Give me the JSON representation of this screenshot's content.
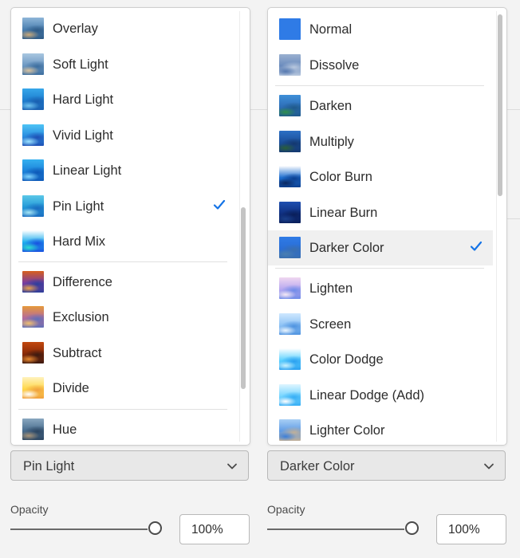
{
  "left": {
    "items": [
      {
        "label": "Overlay",
        "thumb": "ov"
      },
      {
        "label": "Soft Light",
        "thumb": "soft"
      },
      {
        "label": "Hard Light",
        "thumb": "hard"
      },
      {
        "label": "Vivid Light",
        "thumb": "vivid"
      },
      {
        "label": "Linear Light",
        "thumb": "linl"
      },
      {
        "label": "Pin Light",
        "thumb": "pin",
        "checked": true
      },
      {
        "label": "Hard Mix",
        "thumb": "mix"
      },
      {
        "label": "Difference",
        "thumb": "diff"
      },
      {
        "label": "Exclusion",
        "thumb": "excl"
      },
      {
        "label": "Subtract",
        "thumb": "sub"
      },
      {
        "label": "Divide",
        "thumb": "div"
      },
      {
        "label": "Hue",
        "thumb": "hue"
      }
    ],
    "picker": {
      "selected": "Pin Light"
    },
    "opacity": {
      "label": "Opacity",
      "value": "100%",
      "level": 1.0
    }
  },
  "right": {
    "items": [
      {
        "label": "Normal",
        "thumb": "normal"
      },
      {
        "label": "Dissolve",
        "thumb": "dissolve"
      },
      {
        "label": "Darken",
        "thumb": "darken"
      },
      {
        "label": "Multiply",
        "thumb": "multiply"
      },
      {
        "label": "Color Burn",
        "thumb": "cburn"
      },
      {
        "label": "Linear Burn",
        "thumb": "lburn"
      },
      {
        "label": "Darker Color",
        "thumb": "darker",
        "checked": true
      },
      {
        "label": "Lighten",
        "thumb": "lighten"
      },
      {
        "label": "Screen",
        "thumb": "screen"
      },
      {
        "label": "Color Dodge",
        "thumb": "cdodge"
      },
      {
        "label": "Linear Dodge (Add)",
        "thumb": "ldodge"
      },
      {
        "label": "Lighter Color",
        "thumb": "lighter"
      }
    ],
    "picker": {
      "selected": "Darker Color"
    },
    "opacity": {
      "label": "Opacity",
      "value": "100%",
      "level": 1.0
    }
  },
  "colors": {
    "accent": "#1473e6",
    "check": "#1473e6"
  },
  "icons": {
    "check": "checkmark-icon",
    "chevron": "chevron-down-icon"
  }
}
